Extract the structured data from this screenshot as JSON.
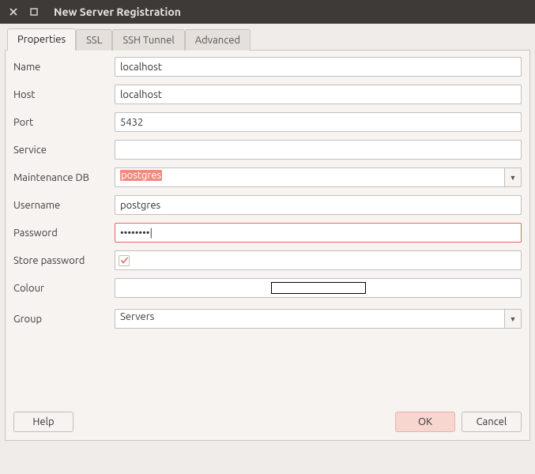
{
  "window": {
    "title": "New Server Registration"
  },
  "tabs": {
    "items": [
      {
        "label": "Properties"
      },
      {
        "label": "SSL"
      },
      {
        "label": "SSH Tunnel"
      },
      {
        "label": "Advanced"
      }
    ],
    "active_index": 0
  },
  "form": {
    "name": {
      "label": "Name",
      "value": "localhost"
    },
    "host": {
      "label": "Host",
      "value": "localhost"
    },
    "port": {
      "label": "Port",
      "value": "5432"
    },
    "service": {
      "label": "Service",
      "value": ""
    },
    "maintenance_db": {
      "label": "Maintenance DB",
      "value": "postgres"
    },
    "username": {
      "label": "Username",
      "value": "postgres"
    },
    "password": {
      "label": "Password",
      "value": "••••••••"
    },
    "store_password": {
      "label": "Store password",
      "checked": true
    },
    "colour": {
      "label": "Colour",
      "swatch": "#ffffff"
    },
    "group": {
      "label": "Group",
      "value": "Servers"
    }
  },
  "buttons": {
    "help": "Help",
    "ok": "OK",
    "cancel": "Cancel"
  }
}
